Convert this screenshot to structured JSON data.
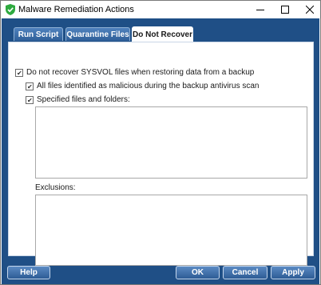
{
  "window": {
    "title": "Malware Remediation Actions",
    "app_icon": "shield-check-icon",
    "accent_color": "#1f4f86",
    "controls": [
      "minimize-icon",
      "maximize-icon",
      "close-icon"
    ]
  },
  "tabs": [
    {
      "label": "Run Script",
      "active": false
    },
    {
      "label": "Quarantine Files",
      "active": false
    },
    {
      "label": "Do Not Recover",
      "active": true
    }
  ],
  "options": {
    "sysvol": {
      "label": "Do not recover SYSVOL files when restoring data from a backup",
      "checked": true
    },
    "malicious": {
      "label": "All files identified as malicious during the backup antivirus scan",
      "checked": true
    },
    "specified": {
      "label": "Specified files and folders:",
      "checked": true
    }
  },
  "exclusions": {
    "label": "Exclusions:"
  },
  "buttons": {
    "help": "Help",
    "ok": "OK",
    "cancel": "Cancel",
    "apply": "Apply"
  }
}
